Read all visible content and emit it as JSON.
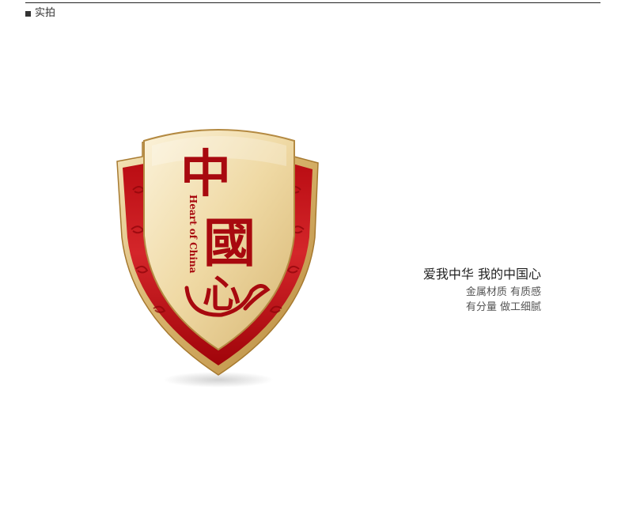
{
  "header": {
    "section_title": "实拍"
  },
  "badge": {
    "big_character_1": "中",
    "big_character_2": "國",
    "big_character_3": "心",
    "vertical_text": "Heart of China"
  },
  "tagline": {
    "title": "爱我中华 我的中国心",
    "line1": "金属材质 有质感",
    "line2": "有分量 做工细腻"
  },
  "colors": {
    "gold": "#e8cf9a",
    "red": "#c41a1a"
  }
}
